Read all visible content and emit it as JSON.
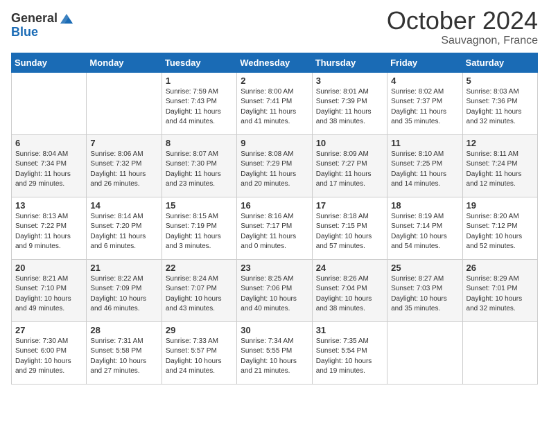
{
  "header": {
    "logo_general": "General",
    "logo_blue": "Blue",
    "month": "October 2024",
    "location": "Sauvagnon, France"
  },
  "weekdays": [
    "Sunday",
    "Monday",
    "Tuesday",
    "Wednesday",
    "Thursday",
    "Friday",
    "Saturday"
  ],
  "rows": [
    [
      {
        "num": "",
        "info": ""
      },
      {
        "num": "",
        "info": ""
      },
      {
        "num": "1",
        "info": "Sunrise: 7:59 AM\nSunset: 7:43 PM\nDaylight: 11 hours and 44 minutes."
      },
      {
        "num": "2",
        "info": "Sunrise: 8:00 AM\nSunset: 7:41 PM\nDaylight: 11 hours and 41 minutes."
      },
      {
        "num": "3",
        "info": "Sunrise: 8:01 AM\nSunset: 7:39 PM\nDaylight: 11 hours and 38 minutes."
      },
      {
        "num": "4",
        "info": "Sunrise: 8:02 AM\nSunset: 7:37 PM\nDaylight: 11 hours and 35 minutes."
      },
      {
        "num": "5",
        "info": "Sunrise: 8:03 AM\nSunset: 7:36 PM\nDaylight: 11 hours and 32 minutes."
      }
    ],
    [
      {
        "num": "6",
        "info": "Sunrise: 8:04 AM\nSunset: 7:34 PM\nDaylight: 11 hours and 29 minutes."
      },
      {
        "num": "7",
        "info": "Sunrise: 8:06 AM\nSunset: 7:32 PM\nDaylight: 11 hours and 26 minutes."
      },
      {
        "num": "8",
        "info": "Sunrise: 8:07 AM\nSunset: 7:30 PM\nDaylight: 11 hours and 23 minutes."
      },
      {
        "num": "9",
        "info": "Sunrise: 8:08 AM\nSunset: 7:29 PM\nDaylight: 11 hours and 20 minutes."
      },
      {
        "num": "10",
        "info": "Sunrise: 8:09 AM\nSunset: 7:27 PM\nDaylight: 11 hours and 17 minutes."
      },
      {
        "num": "11",
        "info": "Sunrise: 8:10 AM\nSunset: 7:25 PM\nDaylight: 11 hours and 14 minutes."
      },
      {
        "num": "12",
        "info": "Sunrise: 8:11 AM\nSunset: 7:24 PM\nDaylight: 11 hours and 12 minutes."
      }
    ],
    [
      {
        "num": "13",
        "info": "Sunrise: 8:13 AM\nSunset: 7:22 PM\nDaylight: 11 hours and 9 minutes."
      },
      {
        "num": "14",
        "info": "Sunrise: 8:14 AM\nSunset: 7:20 PM\nDaylight: 11 hours and 6 minutes."
      },
      {
        "num": "15",
        "info": "Sunrise: 8:15 AM\nSunset: 7:19 PM\nDaylight: 11 hours and 3 minutes."
      },
      {
        "num": "16",
        "info": "Sunrise: 8:16 AM\nSunset: 7:17 PM\nDaylight: 11 hours and 0 minutes."
      },
      {
        "num": "17",
        "info": "Sunrise: 8:18 AM\nSunset: 7:15 PM\nDaylight: 10 hours and 57 minutes."
      },
      {
        "num": "18",
        "info": "Sunrise: 8:19 AM\nSunset: 7:14 PM\nDaylight: 10 hours and 54 minutes."
      },
      {
        "num": "19",
        "info": "Sunrise: 8:20 AM\nSunset: 7:12 PM\nDaylight: 10 hours and 52 minutes."
      }
    ],
    [
      {
        "num": "20",
        "info": "Sunrise: 8:21 AM\nSunset: 7:10 PM\nDaylight: 10 hours and 49 minutes."
      },
      {
        "num": "21",
        "info": "Sunrise: 8:22 AM\nSunset: 7:09 PM\nDaylight: 10 hours and 46 minutes."
      },
      {
        "num": "22",
        "info": "Sunrise: 8:24 AM\nSunset: 7:07 PM\nDaylight: 10 hours and 43 minutes."
      },
      {
        "num": "23",
        "info": "Sunrise: 8:25 AM\nSunset: 7:06 PM\nDaylight: 10 hours and 40 minutes."
      },
      {
        "num": "24",
        "info": "Sunrise: 8:26 AM\nSunset: 7:04 PM\nDaylight: 10 hours and 38 minutes."
      },
      {
        "num": "25",
        "info": "Sunrise: 8:27 AM\nSunset: 7:03 PM\nDaylight: 10 hours and 35 minutes."
      },
      {
        "num": "26",
        "info": "Sunrise: 8:29 AM\nSunset: 7:01 PM\nDaylight: 10 hours and 32 minutes."
      }
    ],
    [
      {
        "num": "27",
        "info": "Sunrise: 7:30 AM\nSunset: 6:00 PM\nDaylight: 10 hours and 29 minutes."
      },
      {
        "num": "28",
        "info": "Sunrise: 7:31 AM\nSunset: 5:58 PM\nDaylight: 10 hours and 27 minutes."
      },
      {
        "num": "29",
        "info": "Sunrise: 7:33 AM\nSunset: 5:57 PM\nDaylight: 10 hours and 24 minutes."
      },
      {
        "num": "30",
        "info": "Sunrise: 7:34 AM\nSunset: 5:55 PM\nDaylight: 10 hours and 21 minutes."
      },
      {
        "num": "31",
        "info": "Sunrise: 7:35 AM\nSunset: 5:54 PM\nDaylight: 10 hours and 19 minutes."
      },
      {
        "num": "",
        "info": ""
      },
      {
        "num": "",
        "info": ""
      }
    ]
  ]
}
